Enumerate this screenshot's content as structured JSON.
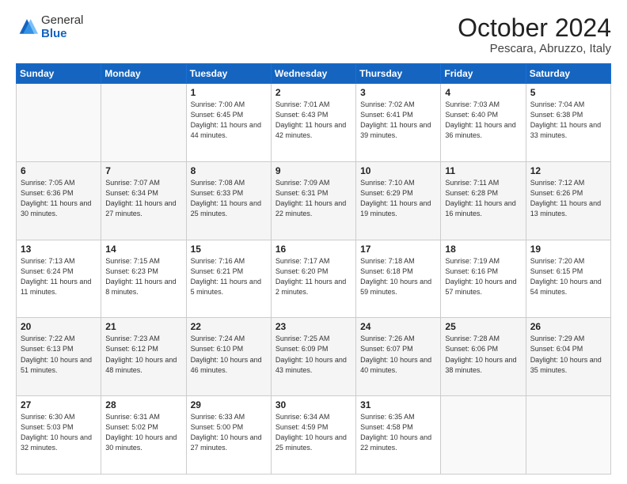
{
  "header": {
    "logo_general": "General",
    "logo_blue": "Blue",
    "month_title": "October 2024",
    "subtitle": "Pescara, Abruzzo, Italy"
  },
  "days_of_week": [
    "Sunday",
    "Monday",
    "Tuesday",
    "Wednesday",
    "Thursday",
    "Friday",
    "Saturday"
  ],
  "weeks": [
    [
      {
        "day": "",
        "info": ""
      },
      {
        "day": "",
        "info": ""
      },
      {
        "day": "1",
        "info": "Sunrise: 7:00 AM\nSunset: 6:45 PM\nDaylight: 11 hours and 44 minutes."
      },
      {
        "day": "2",
        "info": "Sunrise: 7:01 AM\nSunset: 6:43 PM\nDaylight: 11 hours and 42 minutes."
      },
      {
        "day": "3",
        "info": "Sunrise: 7:02 AM\nSunset: 6:41 PM\nDaylight: 11 hours and 39 minutes."
      },
      {
        "day": "4",
        "info": "Sunrise: 7:03 AM\nSunset: 6:40 PM\nDaylight: 11 hours and 36 minutes."
      },
      {
        "day": "5",
        "info": "Sunrise: 7:04 AM\nSunset: 6:38 PM\nDaylight: 11 hours and 33 minutes."
      }
    ],
    [
      {
        "day": "6",
        "info": "Sunrise: 7:05 AM\nSunset: 6:36 PM\nDaylight: 11 hours and 30 minutes."
      },
      {
        "day": "7",
        "info": "Sunrise: 7:07 AM\nSunset: 6:34 PM\nDaylight: 11 hours and 27 minutes."
      },
      {
        "day": "8",
        "info": "Sunrise: 7:08 AM\nSunset: 6:33 PM\nDaylight: 11 hours and 25 minutes."
      },
      {
        "day": "9",
        "info": "Sunrise: 7:09 AM\nSunset: 6:31 PM\nDaylight: 11 hours and 22 minutes."
      },
      {
        "day": "10",
        "info": "Sunrise: 7:10 AM\nSunset: 6:29 PM\nDaylight: 11 hours and 19 minutes."
      },
      {
        "day": "11",
        "info": "Sunrise: 7:11 AM\nSunset: 6:28 PM\nDaylight: 11 hours and 16 minutes."
      },
      {
        "day": "12",
        "info": "Sunrise: 7:12 AM\nSunset: 6:26 PM\nDaylight: 11 hours and 13 minutes."
      }
    ],
    [
      {
        "day": "13",
        "info": "Sunrise: 7:13 AM\nSunset: 6:24 PM\nDaylight: 11 hours and 11 minutes."
      },
      {
        "day": "14",
        "info": "Sunrise: 7:15 AM\nSunset: 6:23 PM\nDaylight: 11 hours and 8 minutes."
      },
      {
        "day": "15",
        "info": "Sunrise: 7:16 AM\nSunset: 6:21 PM\nDaylight: 11 hours and 5 minutes."
      },
      {
        "day": "16",
        "info": "Sunrise: 7:17 AM\nSunset: 6:20 PM\nDaylight: 11 hours and 2 minutes."
      },
      {
        "day": "17",
        "info": "Sunrise: 7:18 AM\nSunset: 6:18 PM\nDaylight: 10 hours and 59 minutes."
      },
      {
        "day": "18",
        "info": "Sunrise: 7:19 AM\nSunset: 6:16 PM\nDaylight: 10 hours and 57 minutes."
      },
      {
        "day": "19",
        "info": "Sunrise: 7:20 AM\nSunset: 6:15 PM\nDaylight: 10 hours and 54 minutes."
      }
    ],
    [
      {
        "day": "20",
        "info": "Sunrise: 7:22 AM\nSunset: 6:13 PM\nDaylight: 10 hours and 51 minutes."
      },
      {
        "day": "21",
        "info": "Sunrise: 7:23 AM\nSunset: 6:12 PM\nDaylight: 10 hours and 48 minutes."
      },
      {
        "day": "22",
        "info": "Sunrise: 7:24 AM\nSunset: 6:10 PM\nDaylight: 10 hours and 46 minutes."
      },
      {
        "day": "23",
        "info": "Sunrise: 7:25 AM\nSunset: 6:09 PM\nDaylight: 10 hours and 43 minutes."
      },
      {
        "day": "24",
        "info": "Sunrise: 7:26 AM\nSunset: 6:07 PM\nDaylight: 10 hours and 40 minutes."
      },
      {
        "day": "25",
        "info": "Sunrise: 7:28 AM\nSunset: 6:06 PM\nDaylight: 10 hours and 38 minutes."
      },
      {
        "day": "26",
        "info": "Sunrise: 7:29 AM\nSunset: 6:04 PM\nDaylight: 10 hours and 35 minutes."
      }
    ],
    [
      {
        "day": "27",
        "info": "Sunrise: 6:30 AM\nSunset: 5:03 PM\nDaylight: 10 hours and 32 minutes."
      },
      {
        "day": "28",
        "info": "Sunrise: 6:31 AM\nSunset: 5:02 PM\nDaylight: 10 hours and 30 minutes."
      },
      {
        "day": "29",
        "info": "Sunrise: 6:33 AM\nSunset: 5:00 PM\nDaylight: 10 hours and 27 minutes."
      },
      {
        "day": "30",
        "info": "Sunrise: 6:34 AM\nSunset: 4:59 PM\nDaylight: 10 hours and 25 minutes."
      },
      {
        "day": "31",
        "info": "Sunrise: 6:35 AM\nSunset: 4:58 PM\nDaylight: 10 hours and 22 minutes."
      },
      {
        "day": "",
        "info": ""
      },
      {
        "day": "",
        "info": ""
      }
    ]
  ]
}
